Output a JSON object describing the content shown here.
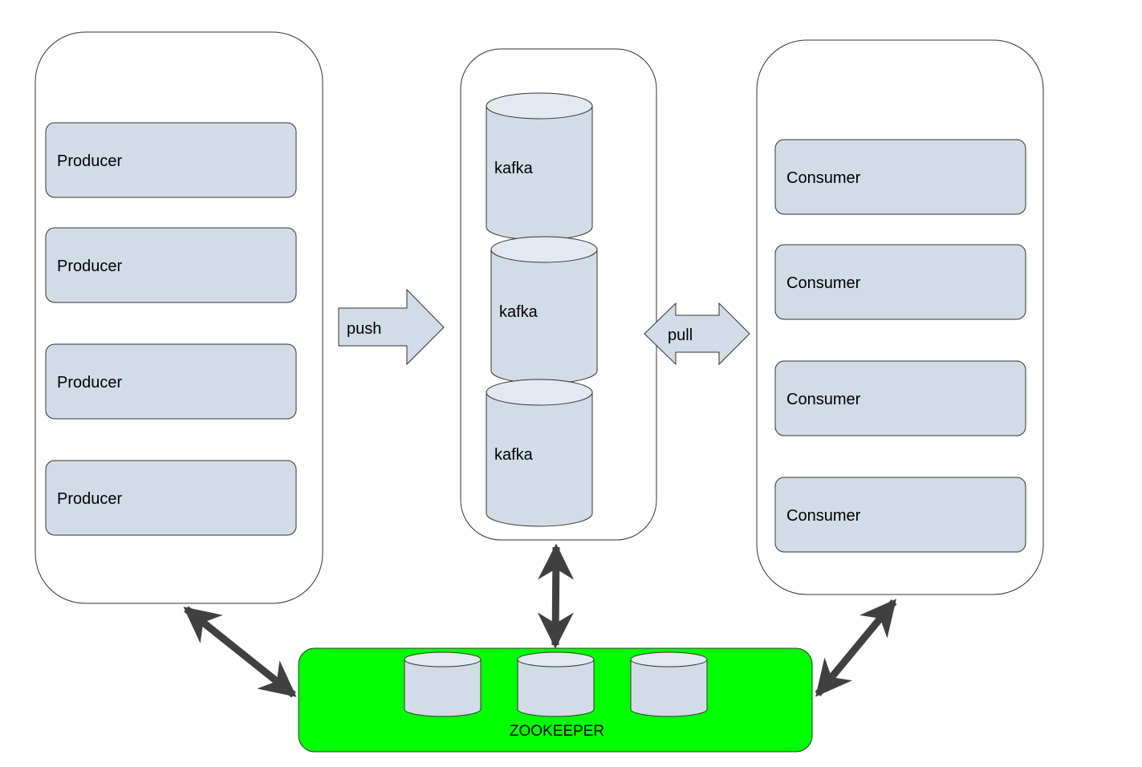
{
  "producers": [
    "Producer",
    "Producer",
    "Producer",
    "Producer"
  ],
  "brokers": [
    "kafka",
    "kafka",
    "kafka"
  ],
  "consumers": [
    "Consumer",
    "Consumer",
    "Consumer",
    "Consumer"
  ],
  "push_label": "push",
  "pull_label": "pull",
  "zookeeper": {
    "label": "ZOOKEEPER",
    "color": "#00ff00",
    "nodes": 3
  },
  "colors": {
    "box_fill": "#d2dce6",
    "connector": "#404040"
  }
}
